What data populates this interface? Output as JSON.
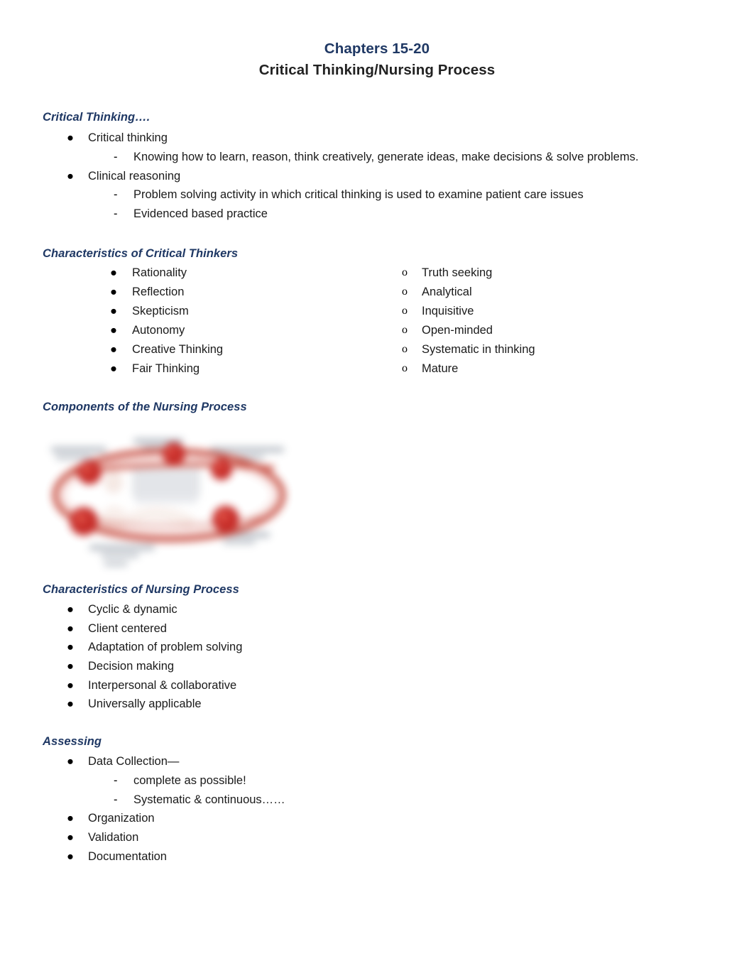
{
  "document": {
    "title_line1": "Chapters 15-20",
    "title_line2": "Critical Thinking/Nursing Process",
    "accent_heading_color": "#1F3864",
    "body_text_color": "#1A1A1A",
    "page_background": "#FFFFFF"
  },
  "sections": [
    {
      "heading": "Critical Thinking….",
      "items": [
        {
          "text": "Critical thinking",
          "sub": [
            "Knowing how to learn, reason, think creatively, generate ideas, make decisions & solve problems."
          ]
        },
        {
          "text": "Clinical reasoning",
          "sub": [
            "Problem solving activity in which critical thinking is used to examine patient care issues",
            "Evidenced based practice"
          ]
        }
      ]
    },
    {
      "heading": "Characteristics of Critical Thinkers",
      "left_column": [
        "Rationality",
        "Reflection",
        "Skepticism",
        "Autonomy",
        "Creative Thinking",
        "Fair Thinking"
      ],
      "right_column": [
        "Truth seeking",
        "Analytical",
        "Inquisitive",
        "Open-minded",
        "Systematic in thinking",
        "Mature"
      ]
    },
    {
      "heading": "Components of the Nursing Process",
      "figure": {
        "name": "nursing-process-cycle-diagram",
        "description": "Blurred circular nursing process cycle diagram with five red node points around a red ellipse and a faint central figure",
        "ring_color": "#C0392B",
        "node_color": "#C21B17",
        "label_color": "#9AA3AE"
      }
    },
    {
      "heading": "Characteristics of Nursing Process",
      "items": [
        {
          "text": "Cyclic & dynamic",
          "sub": []
        },
        {
          "text": "Client centered",
          "sub": []
        },
        {
          "text": "Adaptation of problem solving",
          "sub": []
        },
        {
          "text": "Decision making",
          "sub": []
        },
        {
          "text": "Interpersonal & collaborative",
          "sub": []
        },
        {
          "text": "Universally applicable",
          "sub": []
        }
      ]
    },
    {
      "heading": "Assessing",
      "items": [
        {
          "text": "Data Collection—",
          "sub": [
            "complete as possible!",
            "Systematic & continuous……"
          ]
        },
        {
          "text": "Organization",
          "sub": []
        },
        {
          "text": "Validation",
          "sub": []
        },
        {
          "text": "Documentation",
          "sub": []
        }
      ]
    }
  ],
  "glyphs": {
    "filled_bullet": "●",
    "dash_bullet": "-",
    "circle_bullet": "o"
  }
}
